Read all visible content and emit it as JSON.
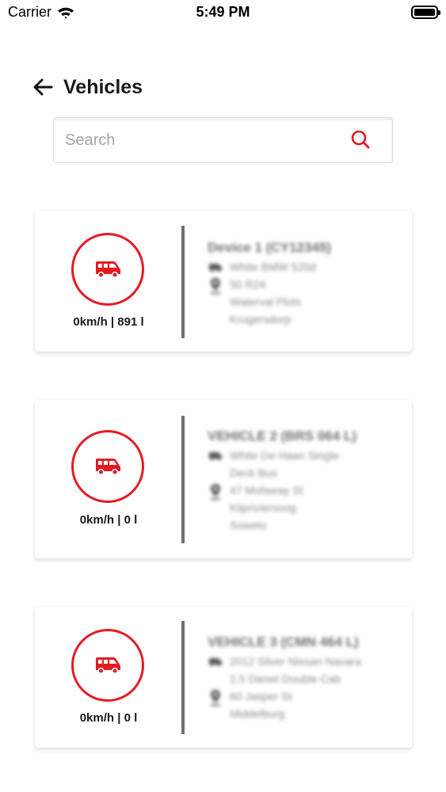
{
  "status_bar": {
    "carrier": "Carrier",
    "time": "5:49 PM",
    "wifi_icon": "wifi-icon",
    "battery_icon": "battery-icon"
  },
  "header": {
    "back_icon": "arrow-left-icon",
    "title": "Vehicles"
  },
  "search": {
    "placeholder": "Search",
    "value": "",
    "icon": "search-icon"
  },
  "colors": {
    "accent": "#e31b23",
    "divider": "#707070",
    "text": "#1a1a1a",
    "placeholder": "#a6a6a6"
  },
  "vehicles": [
    {
      "icon": "van-icon",
      "speed_fuel": "0km/h | 891 l",
      "name": "Device 1 (CY12345)",
      "vehicle_lines": [
        "White BMW 520d"
      ],
      "location_lines": [
        "50 R24",
        "Waterval Plots",
        "Krugersdorp"
      ]
    },
    {
      "icon": "van-icon",
      "speed_fuel": "0km/h | 0 l",
      "name": "VEHICLE 2 (BRS 064 L)",
      "vehicle_lines": [
        "White De Haan Single",
        "Deck Bus"
      ],
      "location_lines": [
        "47 Mofaway St",
        "Klipriviersoog",
        "Soweto"
      ]
    },
    {
      "icon": "van-icon",
      "speed_fuel": "0km/h | 0 l",
      "name": "VEHICLE 3 (CMN 464 L)",
      "vehicle_lines": [
        "2012 Silver Nissan Navara",
        "2.5 Diesel Double Cab"
      ],
      "location_lines": [
        "60 Jasper St",
        "Middelburg"
      ]
    }
  ]
}
